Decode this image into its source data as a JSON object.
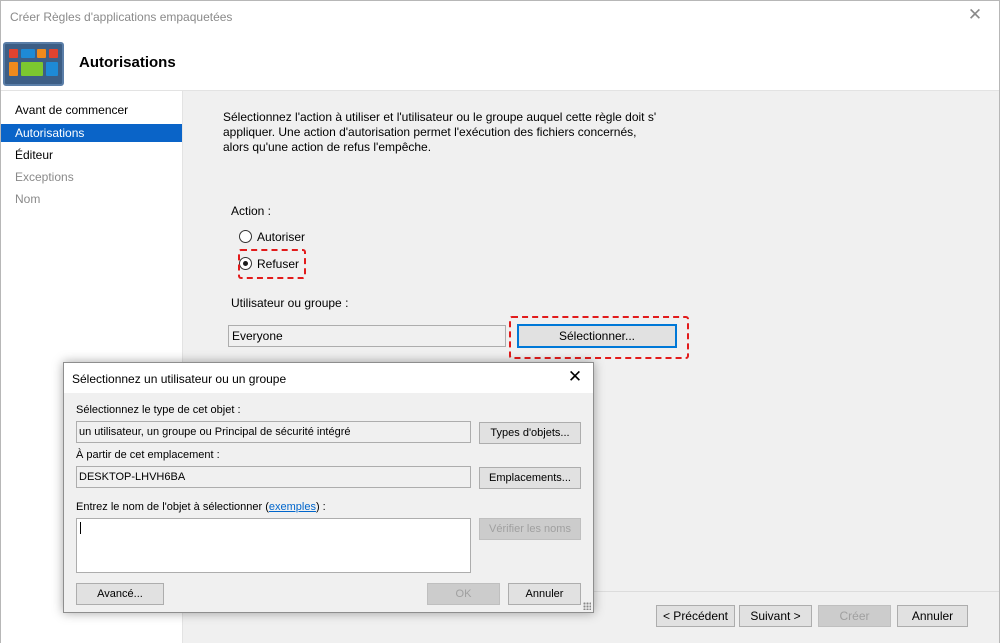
{
  "window": {
    "title": "Créer Règles d'applications empaquetées",
    "close_glyph": "✕",
    "header_title": "Autorisations"
  },
  "sidebar": {
    "items": [
      {
        "label": "Avant de commencer",
        "state": "normal"
      },
      {
        "label": "Autorisations",
        "state": "selected"
      },
      {
        "label": "Éditeur",
        "state": "normal"
      },
      {
        "label": "Exceptions",
        "state": "disabled"
      },
      {
        "label": "Nom",
        "state": "disabled"
      }
    ]
  },
  "content": {
    "description_lines": [
      "Sélectionnez l'action à utiliser et l'utilisateur ou le groupe auquel cette règle doit s'",
      "appliquer. Une action d'autorisation permet l'exécution des fichiers concernés,",
      "alors qu'une action de refus l'empêche."
    ],
    "action_label": "Action :",
    "radio_allow": "Autoriser",
    "radio_deny": "Refuser",
    "selected_action": "Refuser",
    "user_group_label": "Utilisateur ou groupe :",
    "user_group_value": "Everyone",
    "select_button": "Sélectionner..."
  },
  "footer": {
    "previous": "< Précédent",
    "next": "Suivant >",
    "create": "Créer",
    "cancel": "Annuler"
  },
  "dialog": {
    "title": "Sélectionnez un utilisateur ou un groupe",
    "close_glyph": "✕",
    "object_type_label": "Sélectionnez le type de cet objet :",
    "object_type_value": "un utilisateur, un groupe ou Principal de sécurité intégré",
    "object_types_button": "Types d'objets...",
    "location_label": "À partir de cet emplacement :",
    "location_value": "DESKTOP-LHVH6BA",
    "locations_button": "Emplacements...",
    "enter_name_prefix": "Entrez le nom de l'objet à sélectionner (",
    "enter_name_link": "exemples",
    "enter_name_suffix": ") :",
    "object_name_value": "",
    "check_names_button": "Vérifier les noms",
    "advanced_button": "Avancé...",
    "ok_button": "OK",
    "cancel_button": "Annuler"
  },
  "colors": {
    "selection_blue": "#0a64c8",
    "highlight_red": "#e21b1b",
    "link_blue": "#0066cc",
    "focus_border": "#0078d7"
  }
}
